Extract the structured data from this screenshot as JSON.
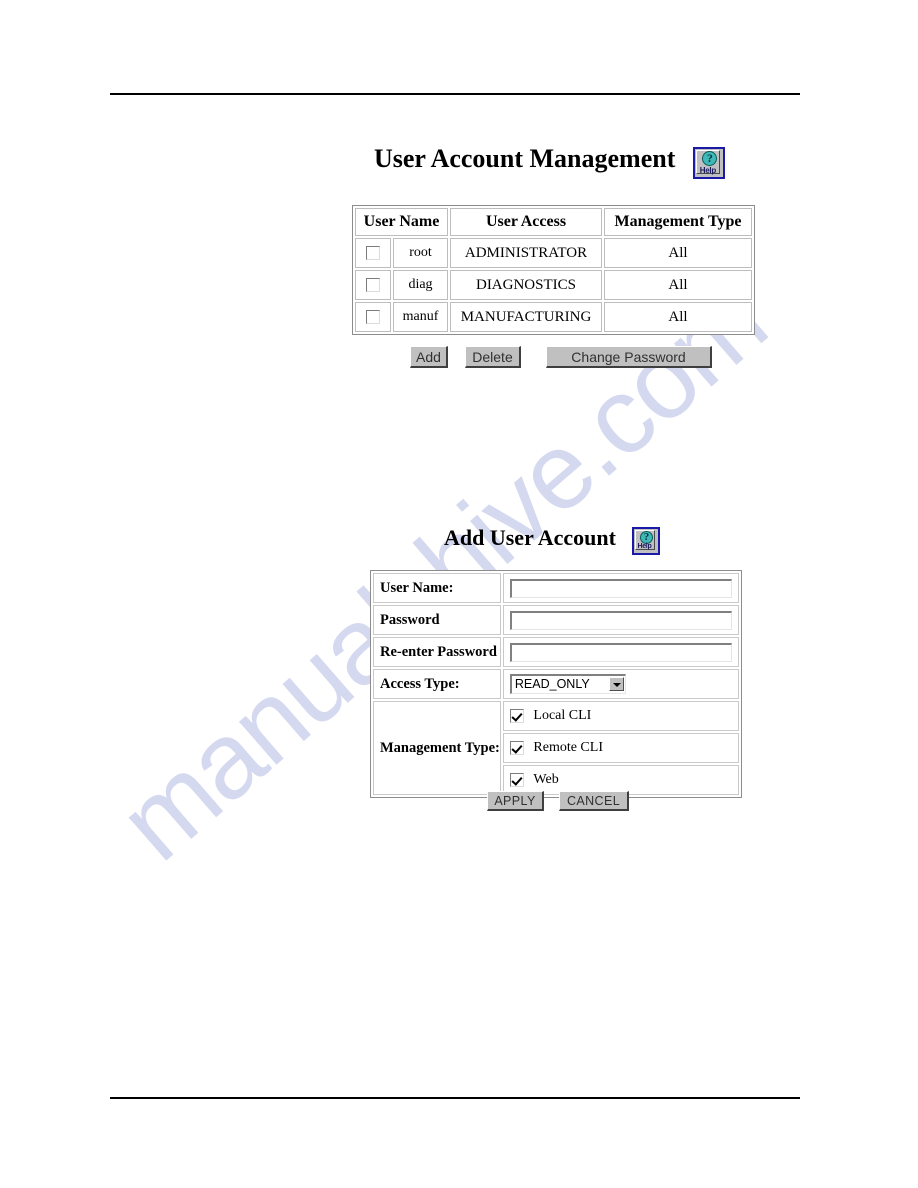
{
  "page": {
    "watermark_text": "manualshive.com",
    "rules": {
      "top": true,
      "bottom": true
    }
  },
  "accounts_section": {
    "title": "User Account Management",
    "help": {
      "glyph": "?",
      "label": "Help",
      "name": "help-icon"
    },
    "table": {
      "columns": [
        "",
        "User Name",
        "User Access",
        "Management Type"
      ],
      "rows": [
        {
          "selected": false,
          "user_name": "root",
          "user_access": "ADMINISTRATOR",
          "management_type": "All"
        },
        {
          "selected": false,
          "user_name": "diag",
          "user_access": "DIAGNOSTICS",
          "management_type": "All"
        },
        {
          "selected": false,
          "user_name": "manuf",
          "user_access": "MANUFACTURING",
          "management_type": "All"
        }
      ]
    },
    "buttons": {
      "add": "Add",
      "delete": "Delete",
      "change_password": "Change Password"
    }
  },
  "add_user_section": {
    "title": "Add User Account",
    "help": {
      "glyph": "?",
      "label": "Help",
      "name": "help-icon"
    },
    "fields": {
      "user_name": {
        "label": "User Name:",
        "value": ""
      },
      "password": {
        "label": "Password",
        "value": ""
      },
      "reenter_password": {
        "label": "Re-enter Password",
        "value": ""
      },
      "access_type": {
        "label": "Access Type:",
        "value": "READ_ONLY",
        "options": [
          "READ_ONLY"
        ]
      },
      "management_type": {
        "label": "Management Type:",
        "items": [
          {
            "label": "Local CLI",
            "checked": true
          },
          {
            "label": "Remote CLI",
            "checked": true
          },
          {
            "label": "Web",
            "checked": true
          }
        ]
      }
    },
    "buttons": {
      "apply": "APPLY",
      "cancel": "CANCEL"
    }
  },
  "colors": {
    "help_border": "#1a1aa8",
    "help_circle": "#3fb8b8",
    "button_face": "#c0c0c0",
    "watermark": "#c6cbeb",
    "text": "#000000"
  }
}
